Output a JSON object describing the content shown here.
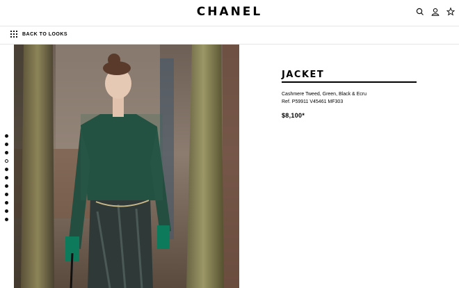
{
  "header": {
    "logo": "CHANEL",
    "icons": [
      "search-icon",
      "account-icon",
      "wishlist-star-icon"
    ]
  },
  "nav": {
    "back_label": "BACK TO LOOKS",
    "back_icon": "grid-icon"
  },
  "carousel": {
    "dot_count": 11,
    "active_index": 3
  },
  "product": {
    "title": "JACKET",
    "description": "Cashmere Tweed, Green, Black & Ecru",
    "reference": "Ref.  P59911 V45461 MF303",
    "price": "$8,100*"
  },
  "colors": {
    "text": "#000000",
    "divider": "#e6e6e6",
    "jacket_green": "#1f4a3c"
  }
}
